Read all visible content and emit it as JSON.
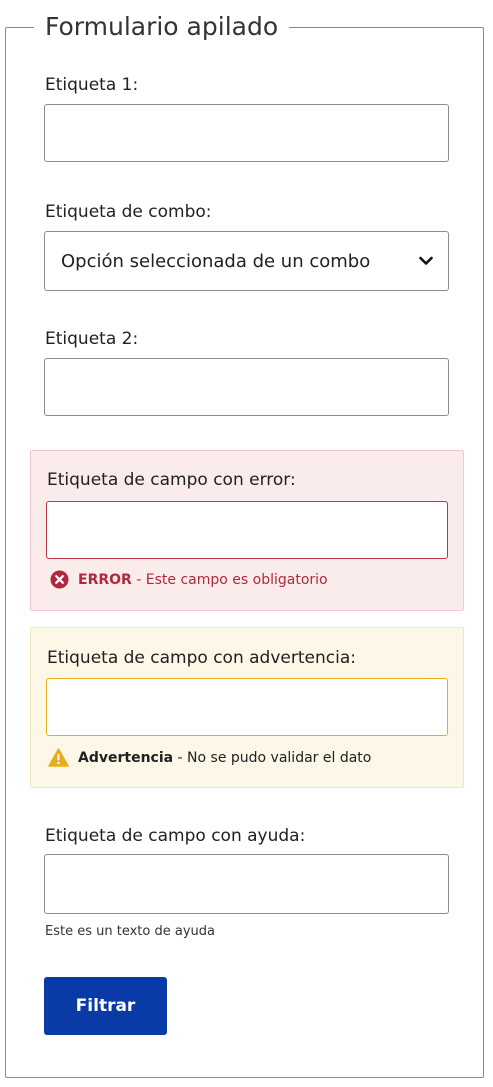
{
  "form": {
    "title": "Formulario apilado",
    "field1": {
      "label": "Etiqueta 1:",
      "value": ""
    },
    "combo": {
      "label": "Etiqueta de combo:",
      "selected": "Opción seleccionada de un combo",
      "icon": "chevron-down-icon"
    },
    "field2": {
      "label": "Etiqueta 2:",
      "value": ""
    },
    "error_field": {
      "label": "Etiqueta de campo con error:",
      "value": "",
      "message_strong": "ERROR",
      "message_text": " - Este campo es obligatorio",
      "icon": "error-circle-icon",
      "color": "#b0283b",
      "background": "#fbecec"
    },
    "warning_field": {
      "label": "Etiqueta de campo con advertencia:",
      "value": "",
      "message_strong": "Advertencia",
      "message_text": " - No se pudo validar el dato",
      "icon": "warning-triangle-icon",
      "color": "#e8ad1b",
      "background": "#fcf7e6"
    },
    "help_field": {
      "label": "Etiqueta de campo con ayuda:",
      "value": "",
      "help_text": "Este es un texto de ayuda"
    },
    "submit_label": "Filtrar",
    "accent_color": "#0a3aa6"
  }
}
